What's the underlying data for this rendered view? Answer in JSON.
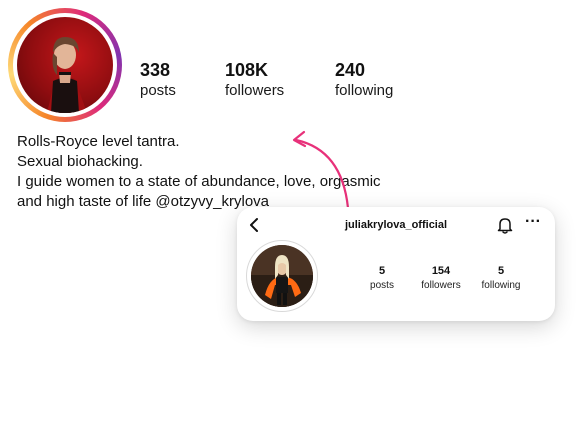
{
  "profile": {
    "stats": [
      {
        "value": "338",
        "label": "posts"
      },
      {
        "value": "108K",
        "label": "followers"
      },
      {
        "value": "240",
        "label": "following"
      }
    ],
    "bio": [
      "Rolls-Royce level tantra.",
      "Sexual biohacking.",
      "I guide women to a state of abundance, love, orgasmic",
      "and high taste of life @otzyvy_krylova"
    ]
  },
  "card": {
    "username": "juliakrylova_official",
    "stats": [
      {
        "value": "5",
        "label": "posts"
      },
      {
        "value": "154",
        "label": "followers"
      },
      {
        "value": "5",
        "label": "following"
      }
    ],
    "icons": {
      "back": "chevron-left-icon",
      "bell": "bell-icon",
      "more": "more-icon"
    }
  },
  "colors": {
    "arrow": "#e8317a",
    "ring_gradient": [
      "#f58529",
      "#feda77",
      "#dd2a7b",
      "#8134af"
    ]
  }
}
